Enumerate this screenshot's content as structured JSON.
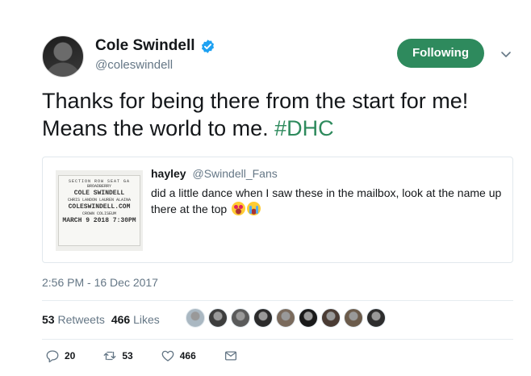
{
  "author": {
    "display_name": "Cole Swindell",
    "handle": "@coleswindell",
    "verified": true,
    "avatar_icon": "avatar"
  },
  "follow_button": {
    "label": "Following"
  },
  "more_menu": {
    "icon": "chevron-down-icon"
  },
  "tweet": {
    "text_line1": "Thanks for being there from the start for me!",
    "text_line2_prefix": "Means the world to me. ",
    "hashtag": "#DHC"
  },
  "quoted_tweet": {
    "name": "hayley",
    "handle": "@Swindell_Fans",
    "text": "did a little dance when I saw these in the mailbox, look at the name up there at the top",
    "emoji": [
      "heart-eyes",
      "crying"
    ],
    "image": {
      "top": "SECTION  ROW  SEAT  GA",
      "line1": "BROADBERRY",
      "line2": "COLE SWINDELL",
      "line3": "CHRIS LANDON LAUREN ALAINA",
      "line4": "COLESWINDELL.COM",
      "line5": "CROWN COLISEUM",
      "line6": "MARCH 9 2018 7:30PM"
    }
  },
  "timestamp": "2:56 PM - 16 Dec 2017",
  "stats": {
    "retweets_count": "53",
    "retweets_label": "Retweets",
    "likes_count": "466",
    "likes_label": "Likes"
  },
  "likers": [
    "#aab8c2",
    "#3d3d3d",
    "#5a5a5a",
    "#2b2b2b",
    "#7a6a5c",
    "#1a1a1a",
    "#4a3b33",
    "#6b5b4b",
    "#2d2d2d"
  ],
  "actions": {
    "reply_count": "20",
    "retweet_count": "53",
    "like_count": "466"
  },
  "colors": {
    "accent": "#2e8a5d",
    "muted": "#657786",
    "verified": "#1da1f2"
  }
}
